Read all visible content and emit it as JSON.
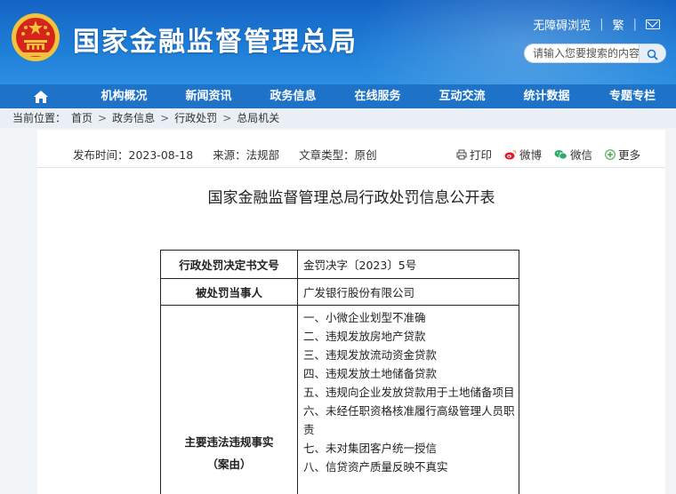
{
  "header": {
    "site_title": "国家金融监督管理总局",
    "accessibility": "无障碍浏览",
    "traditional": "繁",
    "search": {
      "placeholder": "请输入您要搜索的内容"
    }
  },
  "nav": {
    "items": [
      "机构概况",
      "新闻资讯",
      "政务信息",
      "在线服务",
      "互动交流",
      "统计数据",
      "专题专栏"
    ]
  },
  "breadcrumb": {
    "label": "当前位置：",
    "items": [
      "首页",
      "政务信息",
      "行政处罚",
      "总局机关"
    ]
  },
  "article": {
    "publish_time": "发布时间：2023-08-18",
    "source": "来源：法规部",
    "doc_type": "文章类型：原创",
    "share": {
      "print": "打印",
      "weibo": "微博",
      "wechat": "微信",
      "more": "更多"
    },
    "title": "国家金融监督管理总局行政处罚信息公开表"
  },
  "table": {
    "rows": [
      {
        "key": "行政处罚决定书文号",
        "value": "金罚决字〔2023〕5号"
      },
      {
        "key": "被处罚当事人",
        "value": "广发银行股份有限公司"
      }
    ],
    "facts_key_line1": "主要违法违规事实",
    "facts_key_line2": "（案由）",
    "facts": [
      "一、小微企业划型不准确",
      "二、违规发放房地产贷款",
      "三、违规发放流动资金贷款",
      "四、违规发放土地储备贷款",
      "五、违规向企业发放贷款用于土地储备项目",
      "六、未经任职资格核准履行高级管理人员职责",
      "七、未对集团客户统一授信",
      "八、信贷资产质量反映不真实"
    ]
  },
  "colors": {
    "header_blue": "#1f7fd8",
    "nav_blue": "#1e73c9",
    "emblem_red": "#d6241c",
    "emblem_gold": "#f3c33b"
  }
}
